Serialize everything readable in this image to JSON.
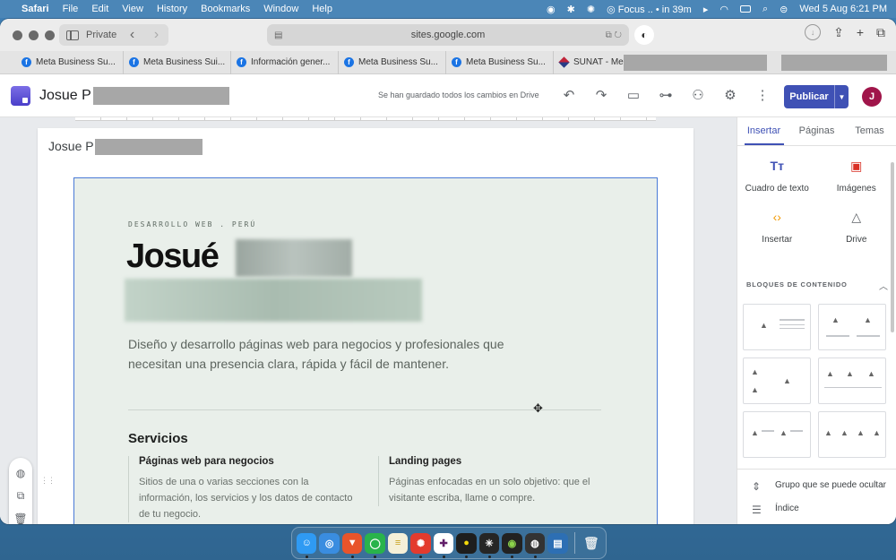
{
  "menubar": {
    "app": "Safari",
    "menus": [
      "File",
      "Edit",
      "View",
      "History",
      "Bookmarks",
      "Window",
      "Help"
    ],
    "focus": "Focus .. • in 39m",
    "datetime": "Wed 5 Aug  6:21 PM"
  },
  "browser": {
    "private_label": "Private",
    "url": "sites.google.com",
    "tabs": [
      {
        "label": "Meta Business Su...",
        "icon": "facebook"
      },
      {
        "label": "Meta Business Sui...",
        "icon": "facebook"
      },
      {
        "label": "Información gener...",
        "icon": "facebook"
      },
      {
        "label": "Meta Business Su...",
        "icon": "facebook"
      },
      {
        "label": "Meta Business Su...",
        "icon": "facebook"
      },
      {
        "label": "SUNAT - Menú",
        "icon": "sunat"
      }
    ]
  },
  "sites_header": {
    "title": "Josue P",
    "saved_status": "Se han guardado todos los cambios en Drive",
    "publish_label": "Publicar",
    "avatar_initial": "J"
  },
  "page": {
    "site_title": "Josue P",
    "eyebrow": "DESARROLLO WEB . PERÚ",
    "hero_name": "Josué",
    "tagline": "Diseño y desarrollo páginas web para negocios y profesionales que necesitan una presencia clara, rápida y fácil de mantener.",
    "services_title": "Servicios",
    "services": [
      {
        "title": "Páginas web para negocios",
        "desc": "Sitios de una o varias secciones con la información, los servicios y los datos de contacto de tu negocio."
      },
      {
        "title": "Landing pages",
        "desc": "Páginas enfocadas en un solo objetivo: que el visitante escriba, llame o compre."
      }
    ]
  },
  "panel": {
    "tabs": [
      "Insertar",
      "Páginas",
      "Temas"
    ],
    "active_tab": "Insertar",
    "insert_items": [
      {
        "label": "Cuadro de texto",
        "icon": "text-box-icon"
      },
      {
        "label": "Imágenes",
        "icon": "image-icon"
      },
      {
        "label": "Insertar",
        "icon": "embed-icon"
      },
      {
        "label": "Drive",
        "icon": "drive-icon"
      }
    ],
    "blocks_heading": "BLOQUES DE CONTENIDO",
    "bottom_items": [
      {
        "label": "Grupo que se puede ocultar",
        "icon": "collapsible-icon"
      },
      {
        "label": "Índice",
        "icon": "toc-icon"
      }
    ]
  },
  "colors": {
    "accent": "#3f51b5",
    "section_bg": "#e9efea",
    "selection": "#4a7ad6",
    "avatar": "#a0154a"
  }
}
